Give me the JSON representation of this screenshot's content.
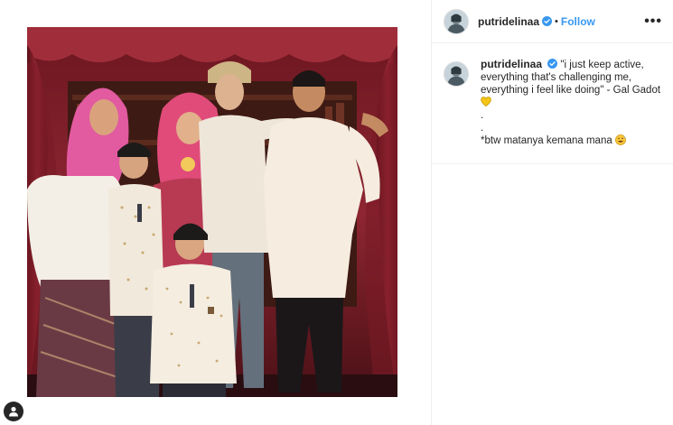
{
  "post": {
    "username": "putridelinaa",
    "separator": "•",
    "follow_label": "Follow",
    "more_label": "•••",
    "caption_lines": [
      "\"i just keep active, everything that's challenging me, everything i feel like doing\" - Gal Gadot",
      ".",
      ".",
      "*btw matanya kemana mana"
    ],
    "caption_emojis": [
      "yellow-heart",
      "grinning-sweat"
    ]
  },
  "icons": {
    "verified": "verified-badge-icon",
    "profile_button": "user-icon",
    "more": "more-options-icon"
  },
  "colors": {
    "follow": "#3897f0",
    "verified": "#3897f0",
    "text": "#262626",
    "border": "#efefef",
    "curtain": "#8a1f2c",
    "heart": "#f5c518"
  }
}
